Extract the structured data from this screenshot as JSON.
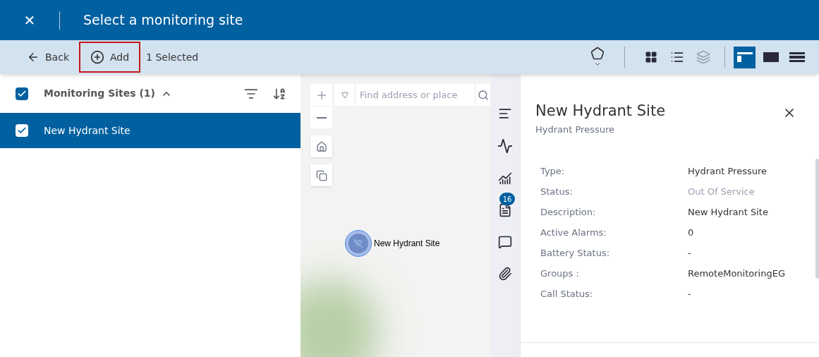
{
  "header": {
    "close_glyph": "✕",
    "title": "Select a monitoring site"
  },
  "toolbar": {
    "back": "Back",
    "add": {
      "label": "Add",
      "highlighted": true
    },
    "selection_count": "1 Selected",
    "view_tools": [
      {
        "kind": "grid",
        "disabled": false
      },
      {
        "kind": "list",
        "disabled": false
      },
      {
        "kind": "layers",
        "disabled": true
      }
    ],
    "layouts": [
      {
        "kind": "split",
        "selected": true
      },
      {
        "kind": "wide",
        "selected": false
      },
      {
        "kind": "rows",
        "selected": false
      }
    ]
  },
  "list": {
    "header": {
      "label": "Monitoring Sites (1)",
      "checked": true,
      "expanded": true
    },
    "items": [
      {
        "label": "New Hydrant Site",
        "checked": true,
        "selected": true
      }
    ]
  },
  "map": {
    "search": {
      "placeholder": "Find address or place"
    },
    "marker_label": "New Hydrant Site"
  },
  "side_tools": [
    {
      "kind": "details"
    },
    {
      "kind": "trend"
    },
    {
      "kind": "chart"
    },
    {
      "kind": "notes",
      "badge": "16"
    },
    {
      "kind": "comments"
    },
    {
      "kind": "attachments"
    }
  ],
  "detail": {
    "title": "New Hydrant Site",
    "subtitle": "Hydrant Pressure",
    "fields": [
      {
        "label": "Type:",
        "value": "Hydrant Pressure",
        "muted": false
      },
      {
        "label": "Status:",
        "value": "Out Of Service",
        "muted": true
      },
      {
        "label": "Description:",
        "value": "New Hydrant Site",
        "muted": false
      },
      {
        "label": "Active Alarms:",
        "value": "0",
        "muted": false
      },
      {
        "label": "Battery Status:",
        "value": "-",
        "muted": false
      },
      {
        "label": "Groups :",
        "value": "RemoteMonitoringEG",
        "muted": false
      },
      {
        "label": "Call Status:",
        "value": "-",
        "muted": false
      }
    ]
  }
}
